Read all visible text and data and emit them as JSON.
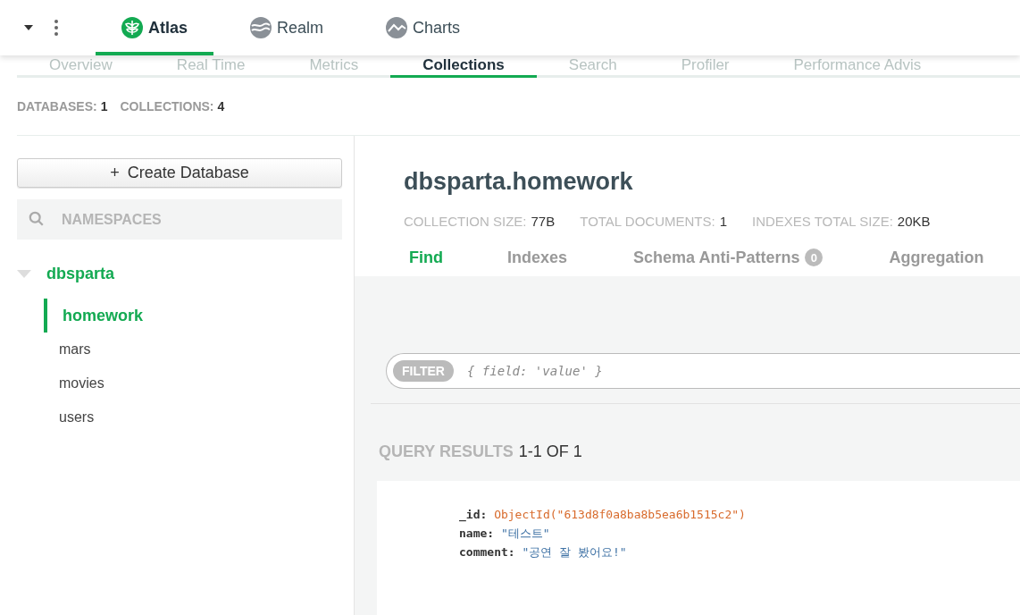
{
  "app_switcher": [
    {
      "label": "Atlas",
      "selected": true,
      "kind": "atlas"
    },
    {
      "label": "Realm",
      "selected": false,
      "kind": "realm"
    },
    {
      "label": "Charts",
      "selected": false,
      "kind": "charts"
    }
  ],
  "cluster_tabs": [
    {
      "label": "Overview",
      "selected": false
    },
    {
      "label": "Real Time",
      "selected": false
    },
    {
      "label": "Metrics",
      "selected": false
    },
    {
      "label": "Collections",
      "selected": true
    },
    {
      "label": "Search",
      "selected": false
    },
    {
      "label": "Profiler",
      "selected": false
    },
    {
      "label": "Performance Advis",
      "selected": false
    }
  ],
  "summary": [
    {
      "label": "DATABASES:",
      "value": "1"
    },
    {
      "label": "COLLECTIONS:",
      "value": "4"
    }
  ],
  "sidebar": {
    "create_button": {
      "icon": "+",
      "label": "Create Database"
    },
    "search": {
      "placeholder": "NAMESPACES"
    },
    "databases": [
      {
        "name": "dbsparta",
        "expanded": true,
        "children": [
          {
            "name": "homework",
            "selected": true
          },
          {
            "name": "mars",
            "selected": false
          },
          {
            "name": "movies",
            "selected": false
          },
          {
            "name": "users",
            "selected": false
          }
        ]
      }
    ]
  },
  "collection": {
    "title": "dbsparta.homework",
    "stats": [
      {
        "label": "COLLECTION SIZE:",
        "value": "77B"
      },
      {
        "label": "TOTAL DOCUMENTS:",
        "value": "1"
      },
      {
        "label": "INDEXES TOTAL SIZE:",
        "value": "20KB"
      }
    ],
    "tabs": [
      {
        "label": "Find",
        "selected": true
      },
      {
        "label": "Indexes",
        "selected": false
      },
      {
        "label": "Schema Anti-Patterns",
        "selected": false,
        "badge": "0"
      },
      {
        "label": "Aggregation",
        "selected": false
      }
    ],
    "filter": {
      "button": "FILTER",
      "placeholder": "{ field: 'value' }"
    },
    "results": {
      "label": "QUERY RESULTS",
      "range": "1-1 OF 1"
    },
    "documents": [
      {
        "fields": [
          {
            "key": "_id:",
            "value": "ObjectId(\"613d8f0a8ba8b5ea6b1515c2\")",
            "kind": "objectid"
          },
          {
            "key": "name:",
            "value": "\"테스트\"",
            "kind": "string"
          },
          {
            "key": "comment:",
            "value": "\"공연 잘 봤어요!\"",
            "kind": "string"
          }
        ]
      }
    ]
  }
}
